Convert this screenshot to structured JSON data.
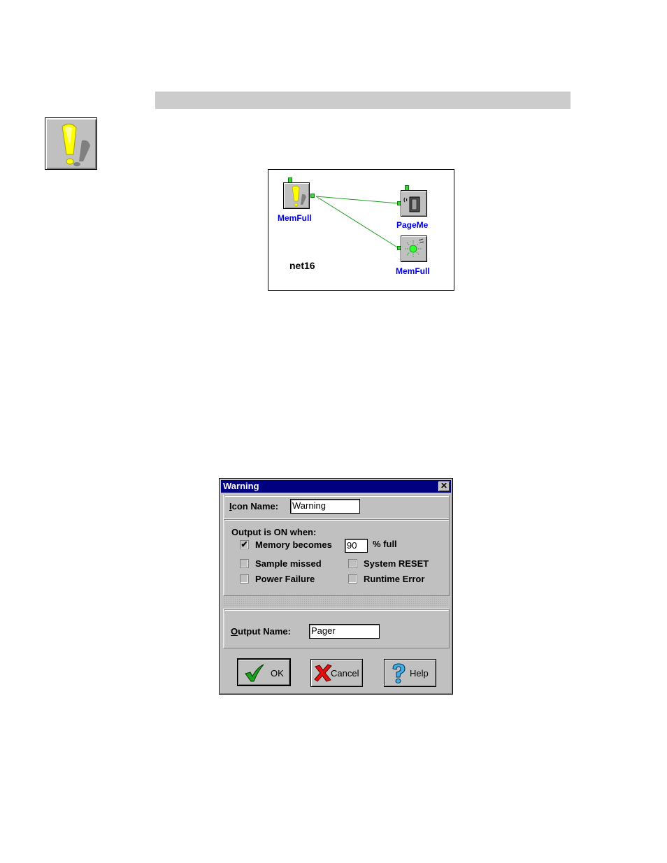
{
  "network": {
    "source_node_label": "MemFull",
    "pager_node_label": "PageMe",
    "output_node_label": "MemFull",
    "net_label": "net16"
  },
  "dialog": {
    "title": "Warning",
    "close_glyph": "✕",
    "icon_name_label_first": "I",
    "icon_name_label_rest": "con Name:",
    "icon_name_value": "Warning",
    "output_group_label": "Output is ON when:",
    "memory_becomes_label": "Memory becomes",
    "memory_percent_value": "90",
    "percent_full_label": "% full",
    "check_glyph": "✔",
    "sample_missed_label": "Sample missed",
    "system_reset_label": "System RESET",
    "power_failure_label": "Power Failure",
    "runtime_error_label": "Runtime Error",
    "output_name_label_first": "O",
    "output_name_label_rest": "utput Name:",
    "output_name_value": "Pager",
    "ok_label": "OK",
    "cancel_label": "Cancel",
    "help_label": "Help"
  },
  "checkboxes": {
    "memory_becomes": true,
    "sample_missed": false,
    "system_reset": false,
    "power_failure": false,
    "runtime_error": false
  },
  "icons": [
    "warning-exclamation-icon",
    "pager-icon",
    "output-light-icon",
    "close-icon",
    "check-icon",
    "cancel-x-icon",
    "help-question-icon"
  ],
  "colors": {
    "title_bar": "#000080",
    "node_label": "#0000e0",
    "connection_line": "#22a022",
    "warning_yellow": "#ffff00"
  }
}
